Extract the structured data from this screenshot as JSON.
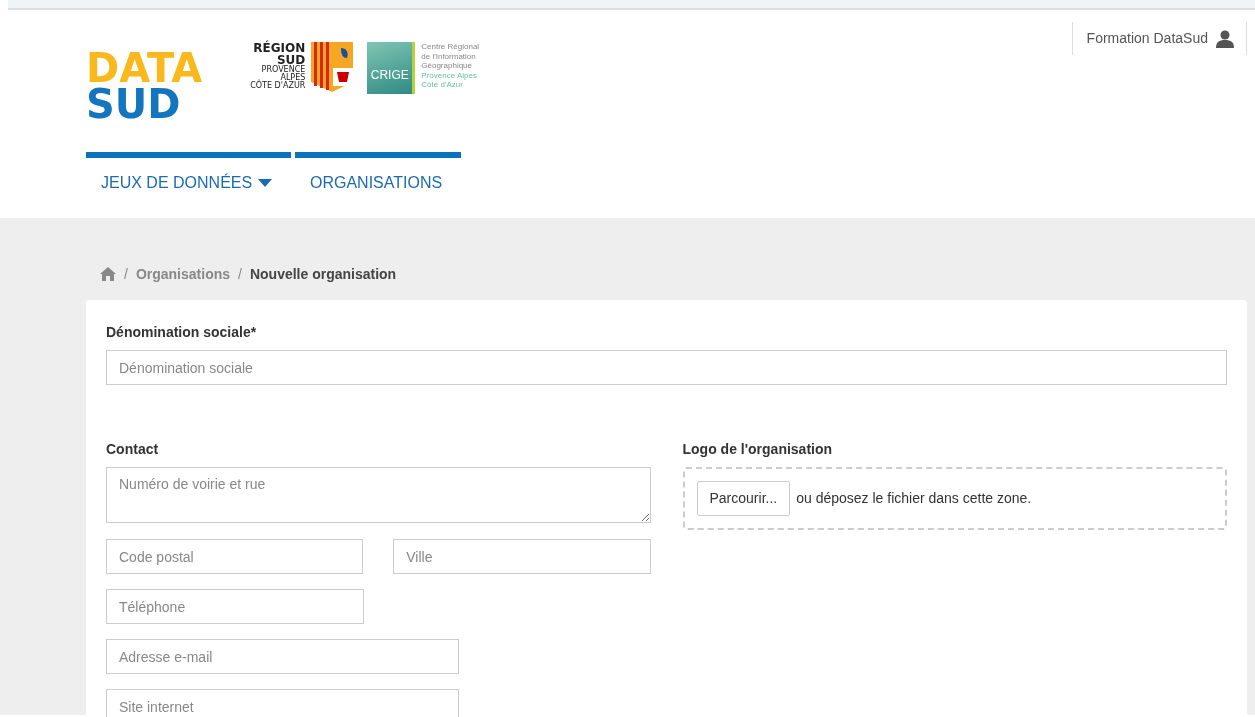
{
  "user_menu": {
    "label": "Formation DataSud"
  },
  "logo": {
    "line_1": "DATA",
    "line_2": "SUD"
  },
  "region_logo": {
    "line_1": "RÉGION",
    "line_2": "SUD",
    "line_3": "PROVENCE",
    "line_4": "ALPES",
    "line_5": "CÔTE D'AZUR"
  },
  "crige_logo": {
    "mark": "CRIGE",
    "line_1": "Centre Régional",
    "line_2": "de l'Information",
    "line_3": "Géographique",
    "line_4": "Provence Alpes",
    "line_5": "Côte d'Azur"
  },
  "nav": [
    {
      "label": "JEUX DE DONNÉES",
      "dropdown": true
    },
    {
      "label": "ORGANISATIONS",
      "dropdown": false
    }
  ],
  "breadcrumb_separator": "/",
  "breadcrumb": [
    {
      "label": "Organisations",
      "current": false
    },
    {
      "label": "Nouvelle organisation",
      "current": true
    }
  ],
  "form": {
    "name_label": "Dénomination sociale*",
    "name_placeholder": "Dénomination sociale",
    "contact_label": "Contact",
    "contact_fields": [
      {
        "kind": "textarea",
        "placeholder": "Numéro de voirie et rue"
      },
      {
        "kind": "pair",
        "placeholder": "Code postal"
      },
      {
        "kind": "pair",
        "placeholder": "Ville"
      },
      {
        "kind": "small",
        "placeholder": "Téléphone"
      },
      {
        "kind": "medium",
        "placeholder": "Adresse e-mail"
      },
      {
        "kind": "medium",
        "placeholder": "Site internet"
      }
    ],
    "logo_label": "Logo de l'organisation",
    "browse_button": "Parcourir...",
    "drop_hint": "ou déposez le fichier dans cette zone."
  }
}
